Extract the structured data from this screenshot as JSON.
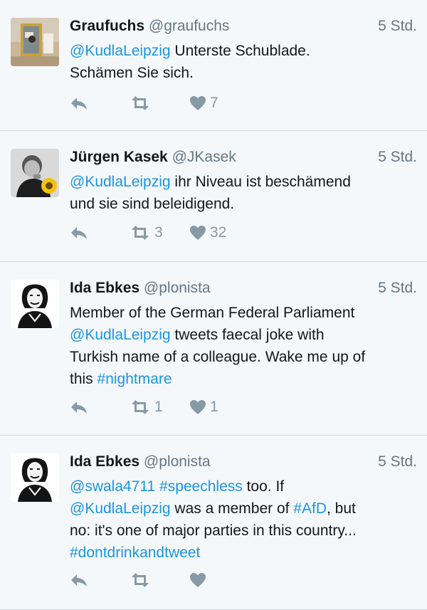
{
  "colors": {
    "link": "#1b95e0",
    "icon": "#8899a6",
    "background": "#f5f8fa",
    "divider": "#cfd8de"
  },
  "tweets": [
    {
      "name": "Graufuchs",
      "handle": "@graufuchs",
      "time": "5 Std.",
      "avatar_icon": "graufuchs-avatar",
      "lines": [
        [
          {
            "t": "@KudlaLeipzig",
            "l": 1
          },
          {
            "t": " Unterste Schublade."
          }
        ],
        [
          {
            "t": "Schämen Sie sich."
          }
        ]
      ],
      "retweets": "",
      "likes": "7"
    },
    {
      "name": "Jürgen Kasek",
      "handle": "@JKasek",
      "time": "5 Std.",
      "avatar_icon": "jkasek-avatar",
      "lines": [
        [
          {
            "t": "@KudlaLeipzig",
            "l": 1
          },
          {
            "t": " ihr Niveau ist beschämend"
          }
        ],
        [
          {
            "t": "und sie sind beleidigend."
          }
        ]
      ],
      "retweets": "3",
      "likes": "32"
    },
    {
      "name": "Ida Ebkes",
      "handle": "@plonista",
      "time": "5 Std.",
      "avatar_icon": "plonista-avatar",
      "lines": [
        [
          {
            "t": "Member of the German Federal Parliament"
          }
        ],
        [
          {
            "t": "@KudlaLeipzig",
            "l": 1
          },
          {
            "t": " tweets faecal joke with"
          }
        ],
        [
          {
            "t": "Turkish name of a colleague. Wake me up of"
          }
        ],
        [
          {
            "t": "this "
          },
          {
            "t": "#nightmare",
            "l": 1
          }
        ]
      ],
      "retweets": "1",
      "likes": "1"
    },
    {
      "name": "Ida Ebkes",
      "handle": "@plonista",
      "time": "5 Std.",
      "avatar_icon": "plonista-avatar",
      "lines": [
        [
          {
            "t": "@swala4711",
            "l": 1
          },
          {
            "t": " "
          },
          {
            "t": "#speechless",
            "l": 1
          },
          {
            "t": " too. If"
          }
        ],
        [
          {
            "t": "@KudlaLeipzig",
            "l": 1
          },
          {
            "t": " was a member of "
          },
          {
            "t": "#AfD",
            "l": 1
          },
          {
            "t": ", but"
          }
        ],
        [
          {
            "t": "no: it's one of major parties in this country..."
          }
        ],
        [
          {
            "t": "#dontdrinkandtweet",
            "l": 1
          }
        ]
      ],
      "retweets": "",
      "likes": ""
    }
  ]
}
